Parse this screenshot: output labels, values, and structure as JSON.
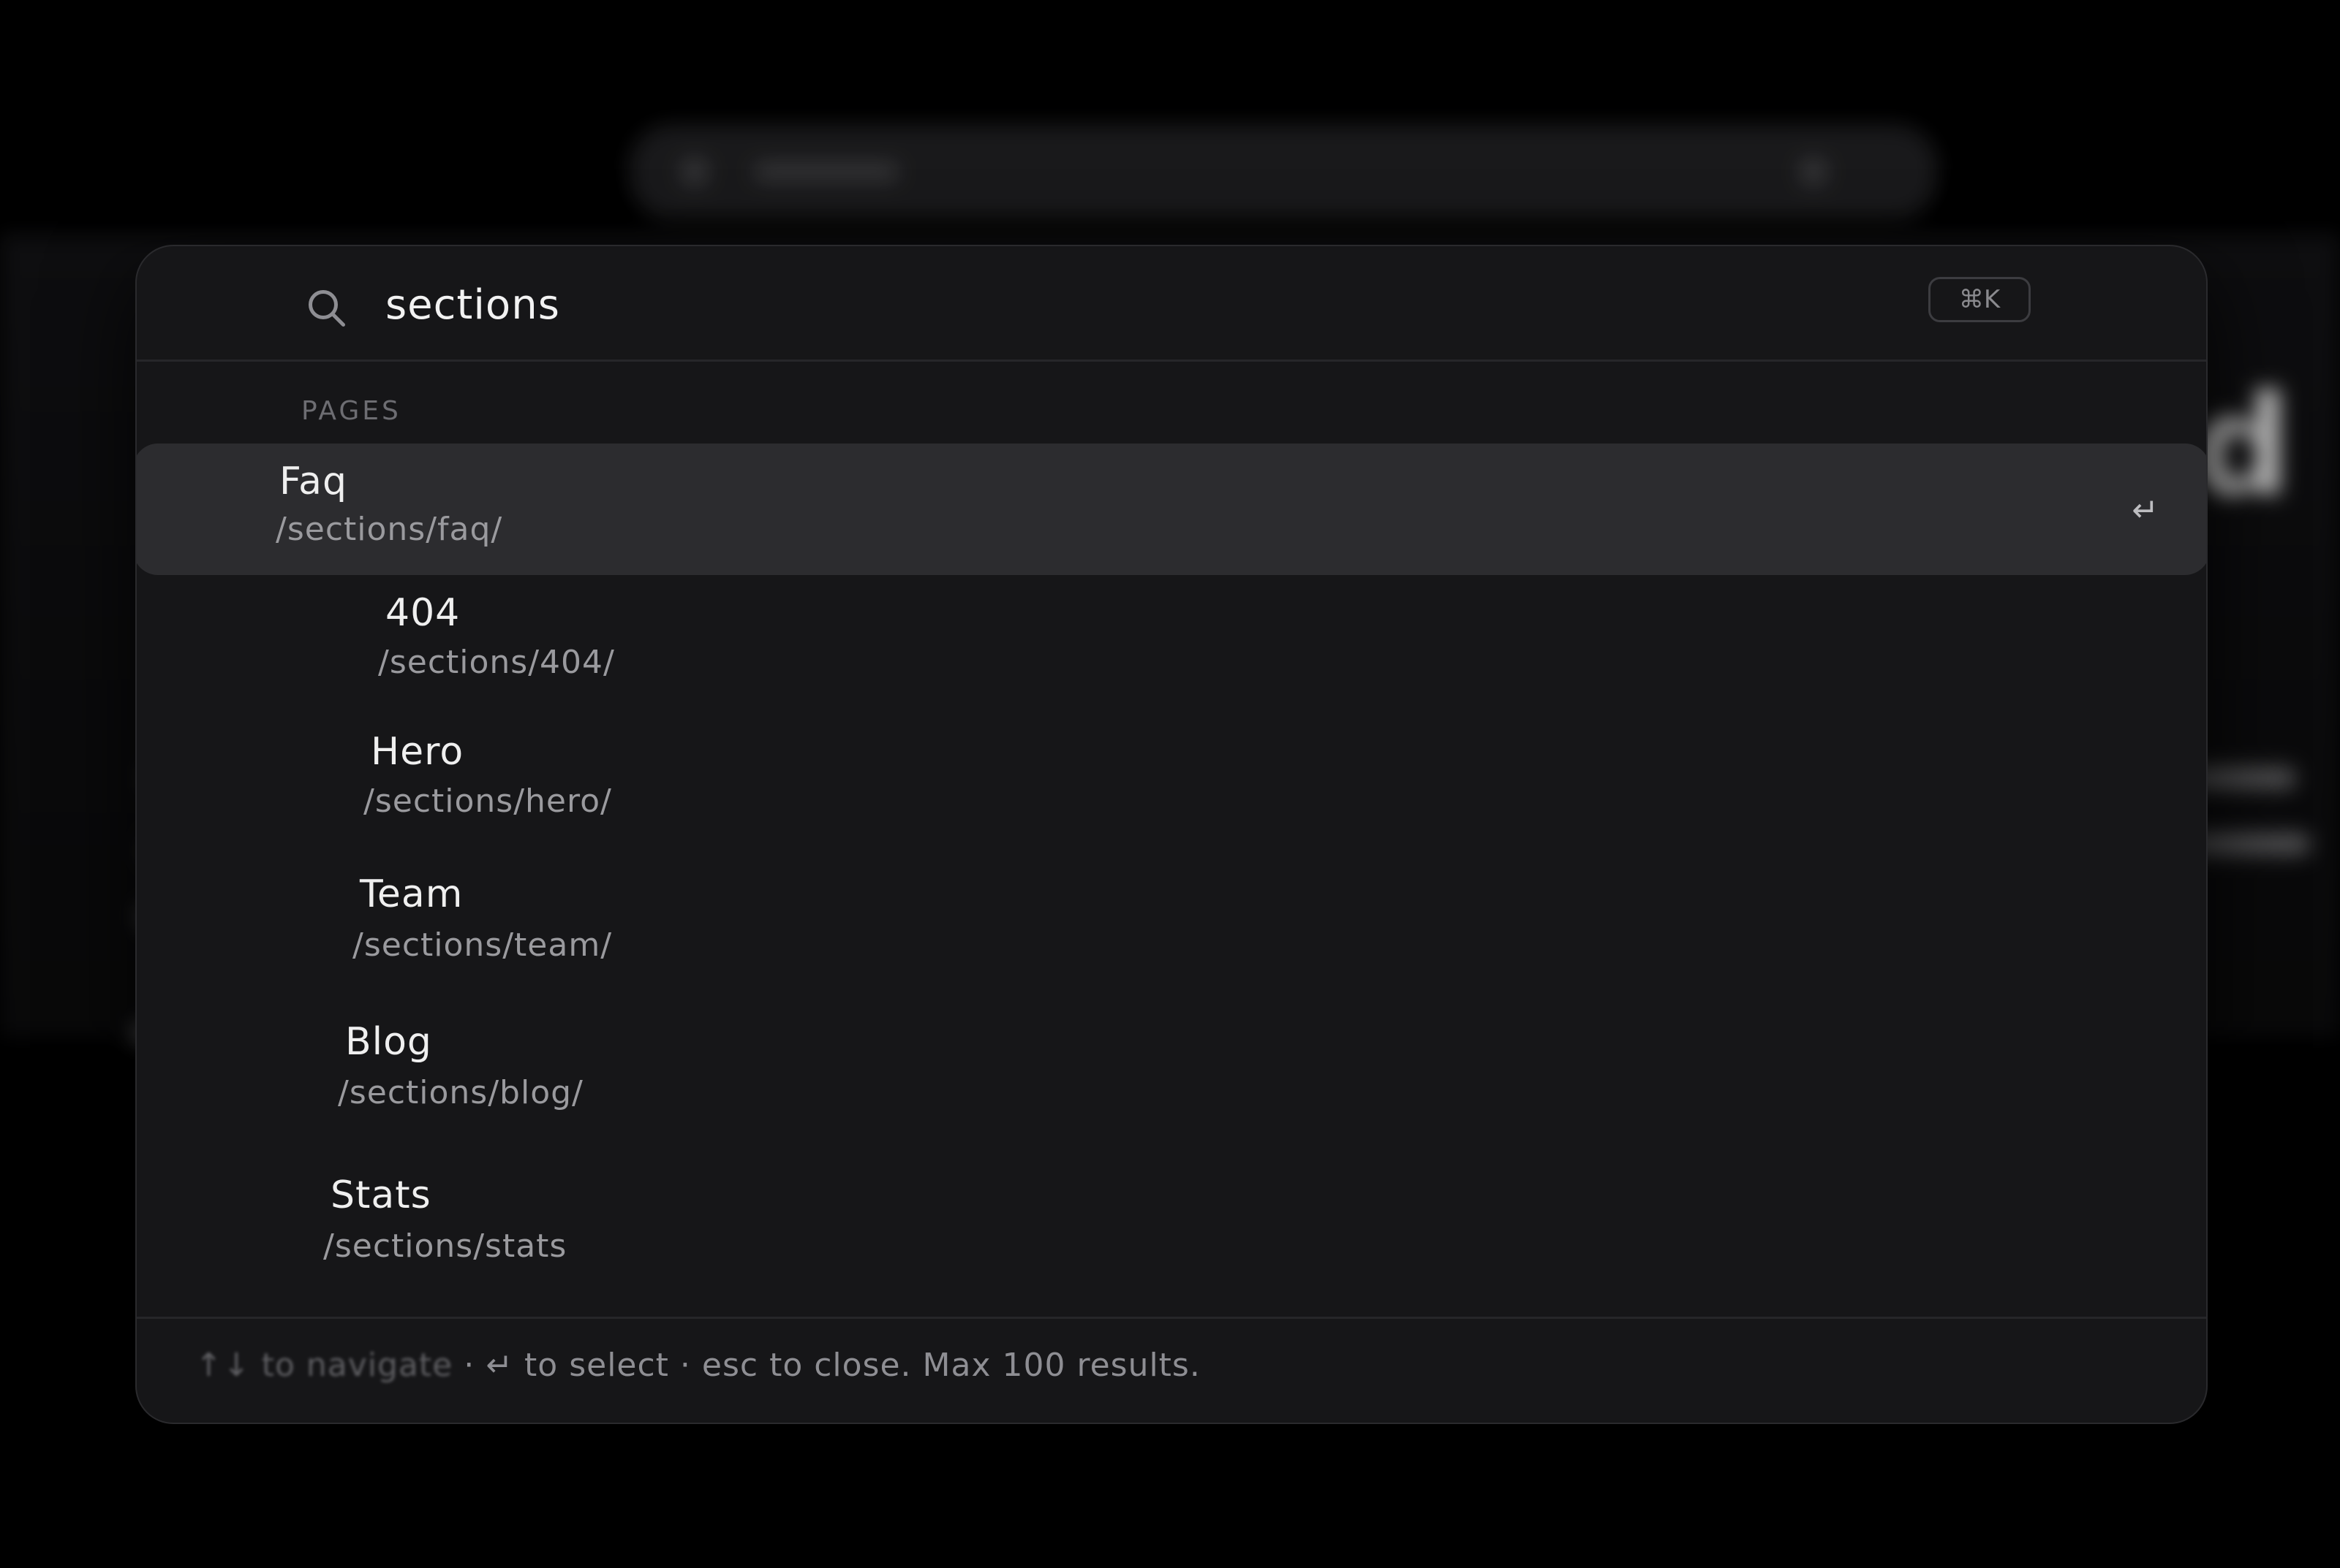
{
  "search": {
    "query": "sections",
    "shortcut": "⌘K",
    "icon": "search-icon"
  },
  "groups": [
    {
      "label": "PAGES",
      "items": [
        {
          "title": "Faq",
          "path": "/sections/faq/",
          "active": true
        },
        {
          "title": "404",
          "path": "/sections/404/",
          "active": false
        },
        {
          "title": "Hero",
          "path": "/sections/hero/",
          "active": false
        },
        {
          "title": "Team",
          "path": "/sections/team/",
          "active": false
        },
        {
          "title": "Blog",
          "path": "/sections/blog/",
          "active": false
        },
        {
          "title": "Stats",
          "path": "/sections/stats",
          "active": false
        }
      ]
    }
  ],
  "active_item": {
    "enter_symbol": "↵"
  },
  "footer": {
    "navigate_hint": "↑↓ to navigate",
    "rest_hint": "· ↵ to select · esc to close. Max 100 results."
  },
  "background": {
    "heading_fragment": "nd"
  },
  "colors": {
    "page_background": "#000000",
    "palette_background": "#161618",
    "active_row": "#2c2c2f",
    "primary_text": "#efefef",
    "secondary_text": "#9a9a9e",
    "muted_text": "#6d6d72"
  }
}
